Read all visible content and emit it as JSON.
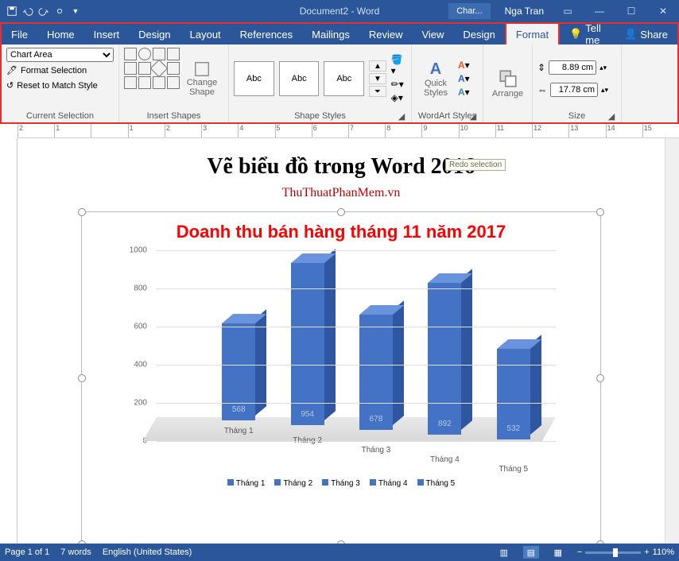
{
  "titlebar": {
    "doc": "Document2 - Word",
    "contextual": "Char...",
    "user": "Nga Tran"
  },
  "tabs": [
    "File",
    "Home",
    "Insert",
    "Design",
    "Layout",
    "References",
    "Mailings",
    "Review",
    "View",
    "Design",
    "Format"
  ],
  "tellme": "Tell me",
  "share": "Share",
  "ribbon": {
    "cs": {
      "dropdown": "Chart Area",
      "fmt": "Format Selection",
      "reset": "Reset to Match Style",
      "label": "Current Selection"
    },
    "shapes": {
      "change": "Change Shape",
      "label": "Insert Shapes"
    },
    "styles": {
      "abc": "Abc",
      "label": "Shape Styles"
    },
    "wa": {
      "quick": "Quick Styles",
      "label": "WordArt Styles"
    },
    "arr": {
      "btn": "Arrange",
      "label": ""
    },
    "sz": {
      "h": "8.89 cm",
      "w": "17.78 cm",
      "label": "Size"
    }
  },
  "page": {
    "h1": "Vẽ biểu đồ trong Word 2016",
    "link": "ThuThuatPhanMem.vn"
  },
  "tooltip": "Redo selection",
  "chart_data": {
    "type": "bar",
    "title": "Doanh thu bán hàng tháng 11 năm 2017",
    "categories": [
      "Tháng 1",
      "Tháng 2",
      "Tháng 3",
      "Tháng 4",
      "Tháng 5"
    ],
    "values": [
      568,
      954,
      678,
      892,
      532
    ],
    "ylim": [
      0,
      1000
    ],
    "ytick": [
      0,
      200,
      400,
      600,
      800,
      1000
    ],
    "legend": [
      "Tháng 1",
      "Tháng 2",
      "Tháng 3",
      "Tháng 4",
      "Tháng 5"
    ]
  },
  "status": {
    "page": "Page 1 of 1",
    "words": "7 words",
    "lang": "English (United States)",
    "zoom": "110%"
  }
}
